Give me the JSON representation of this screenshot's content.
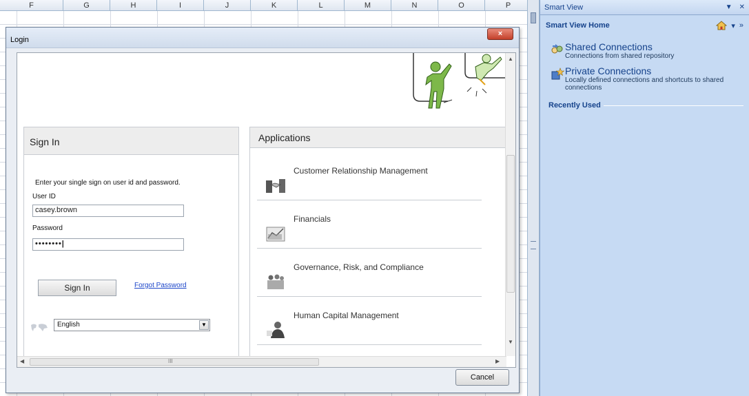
{
  "sheet": {
    "columns": [
      "F",
      "G",
      "H",
      "I",
      "J",
      "K",
      "L",
      "M",
      "N",
      "O",
      "P"
    ]
  },
  "smart_view": {
    "title": "Smart View",
    "home_label": "Smart View Home",
    "items": [
      {
        "icon": "shared-connections-icon",
        "title": "Shared Connections",
        "description": "Connections from shared repository"
      },
      {
        "icon": "private-connections-icon",
        "title": "Private Connections",
        "description": "Locally defined connections and shortcuts to shared connections"
      }
    ],
    "recently_used_label": "Recently Used"
  },
  "login_dialog": {
    "title": "Login",
    "close_glyph": "×",
    "cancel_label": "Cancel",
    "sign_in": {
      "heading": "Sign In",
      "instructions": "Enter your single sign on user id and password.",
      "user_id_label": "User ID",
      "user_id_value": "casey.brown",
      "password_label": "Password",
      "password_value": "••••••••|",
      "button_label": "Sign In",
      "forgot_password_label": "Forgot Password",
      "language_value": "English"
    },
    "applications": {
      "heading": "Applications",
      "items": [
        {
          "label": "Customer Relationship Management",
          "icon": "handshake-icon"
        },
        {
          "label": "Financials",
          "icon": "financials-icon"
        },
        {
          "label": "Governance, Risk, and Compliance",
          "icon": "meeting-icon"
        },
        {
          "label": "Human Capital Management",
          "icon": "person-icon"
        }
      ]
    },
    "scrollbar_grip": "III"
  },
  "colors": {
    "pane_background": "#c6daf3",
    "pane_text": "#15428b",
    "link": "#1b45c9",
    "close_button": "#c3402a"
  }
}
